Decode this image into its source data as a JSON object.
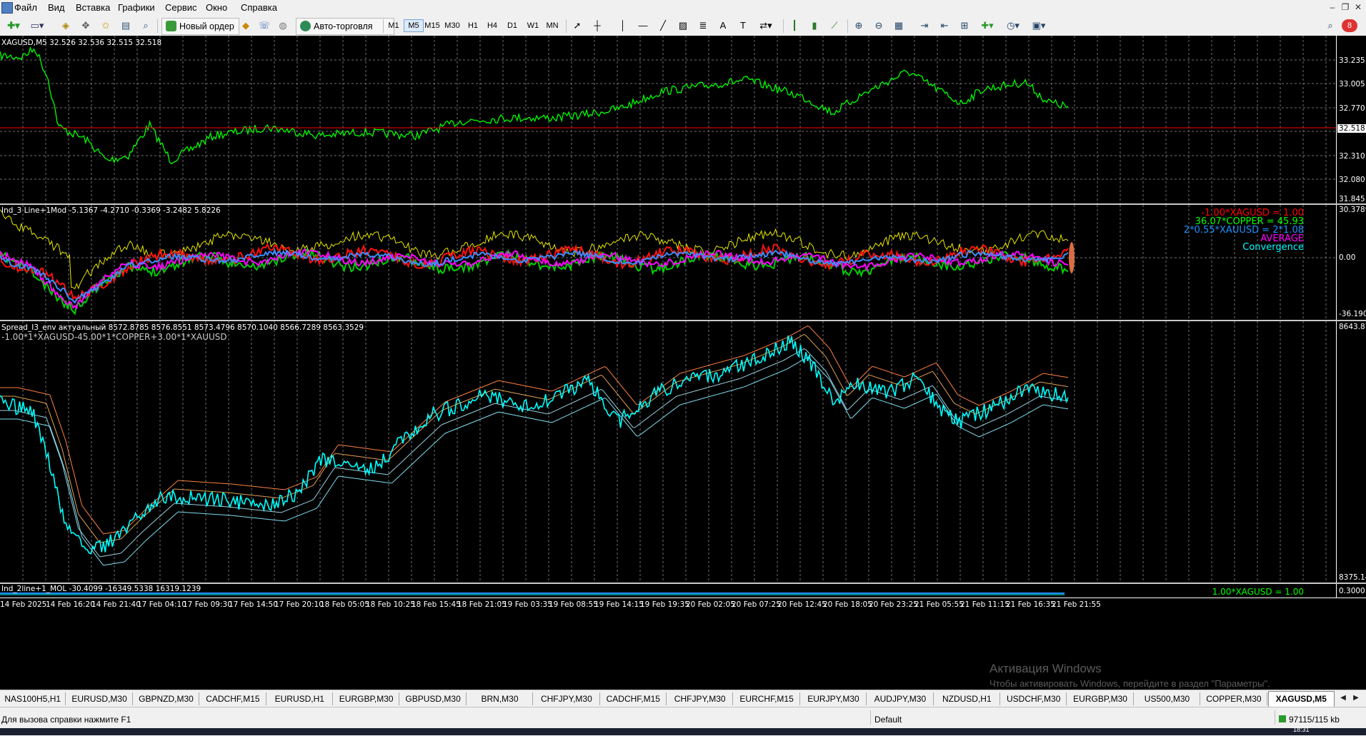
{
  "menu": {
    "items": [
      "Файл",
      "Вид",
      "Вставка",
      "Графики",
      "Сервис",
      "Окно",
      "Справка"
    ]
  },
  "toolbar": {
    "new_order": "Новый ордер",
    "auto_trading": "Авто-торговля",
    "timeframes": [
      "M1",
      "M5",
      "M15",
      "M30",
      "H1",
      "H4",
      "D1",
      "W1",
      "MN"
    ],
    "active_timeframe": "M5"
  },
  "chart": {
    "main_title": "XAGUSD,M5  32.526 32.536 32.515 32.518",
    "main_axis": [
      "33.235",
      "33.005",
      "32.770",
      "32.518",
      "32.310",
      "32.080",
      "31.845"
    ],
    "current_price": "32.518",
    "ind1_title": "Ind_3 Line+1Mod -5.1367 -4.2710 -0.3369 -3.2482 5.8226",
    "ind1_axis_top": "30.3789",
    "ind1_axis_zero": "0.00",
    "ind1_axis_bottom": "-36.1906",
    "ind1_legend": [
      {
        "text": "-1.00*XAGUSD = 1.00",
        "color": "#ff0000"
      },
      {
        "text": "36.07*COPPER = 45.93",
        "color": "#00ff00"
      },
      {
        "text": "2*0.55*XAUUSD = 2*1.08",
        "color": "#1e90ff"
      },
      {
        "text": "AVERAGE",
        "color": "#ff00ff"
      },
      {
        "text": "Convergence",
        "color": "#00ffff"
      }
    ],
    "ind2_title": "Spread_I3_env  актуальный  8572.8785 8576.8551 8573.4796 8570.1040 8566.7289 8563.3529",
    "ind2_formula": "-1.00*1*XAGUSD-45.00*1*COPPER+3.00*1*XAUUSD",
    "ind2_axis_top": "8643.871",
    "ind2_axis_bottom": "8375.141",
    "ind3_title": "Ind_2line+1_MOL -30.4099 -16349.5338 16319.1239",
    "ind3_legend": "1.00*XAGUSD = 1.00",
    "ind3_axis": "0.3000",
    "time_labels": [
      "14 Feb 2025",
      "14 Feb 16:20",
      "14 Feb 21:40",
      "17 Feb 04:10",
      "17 Feb 09:30",
      "17 Feb 14:50",
      "17 Feb 20:10",
      "18 Feb 05:05",
      "18 Feb 10:25",
      "18 Feb 15:45",
      "18 Feb 21:05",
      "19 Feb 03:35",
      "19 Feb 08:55",
      "19 Feb 14:15",
      "19 Feb 19:35",
      "20 Feb 02:05",
      "20 Feb 07:25",
      "20 Feb 12:45",
      "20 Feb 18:05",
      "20 Feb 23:25",
      "21 Feb 05:55",
      "21 Feb 11:15",
      "21 Feb 16:35",
      "21 Feb 21:55"
    ]
  },
  "tabs": {
    "items": [
      "NAS100H5,H1",
      "EURUSD,M30",
      "GBPNZD,M30",
      "CADCHF,M15",
      "EURUSD,H1",
      "EURGBP,M30",
      "GBPUSD,M30",
      "BRN,M30",
      "CHFJPY,M30",
      "CADCHF,M15",
      "CHFJPY,M30",
      "EURCHF,M15",
      "EURJPY,M30",
      "AUDJPY,M30",
      "NZDUSD,H1",
      "USDCHF,M30",
      "EURGBP,M30",
      "US500,M30",
      "COPPER,M30",
      "XAGUSD,M5"
    ],
    "active": "XAGUSD,M5"
  },
  "status": {
    "help": "Для вызова справки нажмите F1",
    "profile": "Default",
    "traffic": "97115/115 kb",
    "clock": "18:31"
  },
  "watermark": {
    "line1": "Активация Windows",
    "line2": "Чтобы активировать Windows, перейдите в раздел \"Параметры\"."
  },
  "colors": {
    "price_line": "#00ff00",
    "spread_line": "#00ffff",
    "bid_line": "#ff0000",
    "background": "#000000",
    "grid": "#808080"
  }
}
